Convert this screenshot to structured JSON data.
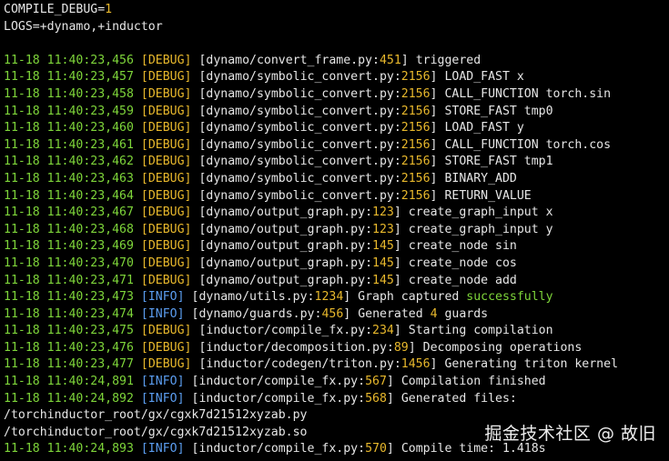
{
  "env": {
    "line1_key": "COMPILE_DEBUG=",
    "line1_val": "1",
    "line2": "LOGS=+dynamo,+inductor"
  },
  "colors": {
    "background": "#000000",
    "text": "#e6e6e6",
    "timestamp": "#7ed53a",
    "debug": "#e8b82c",
    "info": "#5b9df0",
    "line_number": "#e8b82c",
    "success": "#7ed53a"
  },
  "logs": [
    {
      "ts": "11-18 11:40:23,456",
      "level": "DEBUG",
      "module": "dynamo/convert_frame.py",
      "lineno": "451",
      "msg": "triggered"
    },
    {
      "ts": "11-18 11:40:23,457",
      "level": "DEBUG",
      "module": "dynamo/symbolic_convert.py",
      "lineno": "2156",
      "msg": "LOAD_FAST x"
    },
    {
      "ts": "11-18 11:40:23,458",
      "level": "DEBUG",
      "module": "dynamo/symbolic_convert.py",
      "lineno": "2156",
      "msg": "CALL_FUNCTION torch.sin"
    },
    {
      "ts": "11-18 11:40:23,459",
      "level": "DEBUG",
      "module": "dynamo/symbolic_convert.py",
      "lineno": "2156",
      "msg": "STORE_FAST tmp0"
    },
    {
      "ts": "11-18 11:40:23,460",
      "level": "DEBUG",
      "module": "dynamo/symbolic_convert.py",
      "lineno": "2156",
      "msg": "LOAD_FAST y"
    },
    {
      "ts": "11-18 11:40:23,461",
      "level": "DEBUG",
      "module": "dynamo/symbolic_convert.py",
      "lineno": "2156",
      "msg": "CALL_FUNCTION torch.cos"
    },
    {
      "ts": "11-18 11:40:23,462",
      "level": "DEBUG",
      "module": "dynamo/symbolic_convert.py",
      "lineno": "2156",
      "msg": "STORE_FAST tmp1"
    },
    {
      "ts": "11-18 11:40:23,463",
      "level": "DEBUG",
      "module": "dynamo/symbolic_convert.py",
      "lineno": "2156",
      "msg": "BINARY_ADD"
    },
    {
      "ts": "11-18 11:40:23,464",
      "level": "DEBUG",
      "module": "dynamo/symbolic_convert.py",
      "lineno": "2156",
      "msg": "RETURN_VALUE"
    },
    {
      "ts": "11-18 11:40:23,467",
      "level": "DEBUG",
      "module": "dynamo/output_graph.py",
      "lineno": "123",
      "msg": "create_graph_input x"
    },
    {
      "ts": "11-18 11:40:23,468",
      "level": "DEBUG",
      "module": "dynamo/output_graph.py",
      "lineno": "123",
      "msg": "create_graph_input y"
    },
    {
      "ts": "11-18 11:40:23,469",
      "level": "DEBUG",
      "module": "dynamo/output_graph.py",
      "lineno": "145",
      "msg": "create_node sin"
    },
    {
      "ts": "11-18 11:40:23,470",
      "level": "DEBUG",
      "module": "dynamo/output_graph.py",
      "lineno": "145",
      "msg": "create_node cos"
    },
    {
      "ts": "11-18 11:40:23,471",
      "level": "DEBUG",
      "module": "dynamo/output_graph.py",
      "lineno": "145",
      "msg": "create_node add"
    },
    {
      "ts": "11-18 11:40:23,473",
      "level": "INFO",
      "module": "dynamo/utils.py",
      "lineno": "1234",
      "msg": "Graph captured ",
      "highlight": "successfully"
    },
    {
      "ts": "11-18 11:40:23,474",
      "level": "INFO",
      "module": "dynamo/guards.py",
      "lineno": "456",
      "msg": "Generated ",
      "count": "4",
      "msg_tail": " guards"
    },
    {
      "ts": "11-18 11:40:23,475",
      "level": "DEBUG",
      "module": "inductor/compile_fx.py",
      "lineno": "234",
      "msg": "Starting compilation"
    },
    {
      "ts": "11-18 11:40:23,476",
      "level": "DEBUG",
      "module": "inductor/decomposition.py",
      "lineno": "89",
      "msg": "Decomposing operations"
    },
    {
      "ts": "11-18 11:40:23,477",
      "level": "DEBUG",
      "module": "inductor/codegen/triton.py",
      "lineno": "1456",
      "msg": "Generating triton kernel"
    },
    {
      "ts": "11-18 11:40:24,891",
      "level": "INFO",
      "module": "inductor/compile_fx.py",
      "lineno": "567",
      "msg": "Compilation finished"
    },
    {
      "ts": "11-18 11:40:24,892",
      "level": "INFO",
      "module": "inductor/compile_fx.py",
      "lineno": "568",
      "msg": "Generated files:"
    },
    {
      "plain": "/torchinductor_root/gx/cgxk7d21512xyzab.py"
    },
    {
      "plain": "/torchinductor_root/gx/cgxk7d21512xyzab.so"
    },
    {
      "ts": "11-18 11:40:24,893",
      "level": "INFO",
      "module": "inductor/compile_fx.py",
      "lineno": "570",
      "msg": "Compile time: 1.418s"
    }
  ],
  "watermark": "掘金技术社区 @ 故旧"
}
